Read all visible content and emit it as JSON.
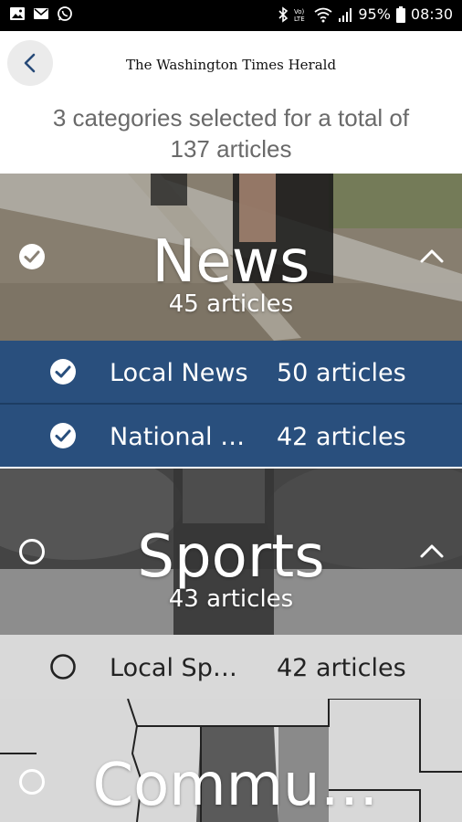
{
  "status_bar": {
    "battery": "95%",
    "time": "08:30",
    "left_icons": [
      "image-icon",
      "mail-icon",
      "whatsapp-icon"
    ],
    "right_icons": [
      "bluetooth-icon",
      "volte-icon",
      "wifi-icon",
      "signal-icon",
      "battery-icon"
    ]
  },
  "header": {
    "back_icon": "chevron-left-icon",
    "masthead": "The Washington Times Herald"
  },
  "summary": {
    "line1": "3 categories selected for a total of",
    "line2": "137 articles"
  },
  "colors": {
    "selected_row": "#294f7d",
    "unselected_row": "#d9d9d9",
    "back_button_bg": "#ebebeb"
  },
  "categories": [
    {
      "title": "News",
      "count": "45 articles",
      "selected": true,
      "subcategories": [
        {
          "label": "Local News",
          "count": "50 articles",
          "selected": true
        },
        {
          "label": "National …",
          "count": "42 articles",
          "selected": true
        }
      ]
    },
    {
      "title": "Sports",
      "count": "43 articles",
      "selected": false,
      "subcategories": [
        {
          "label": "Local Sp…",
          "count": "42 articles",
          "selected": false
        }
      ]
    },
    {
      "title": "Commu…",
      "selected": false
    }
  ]
}
